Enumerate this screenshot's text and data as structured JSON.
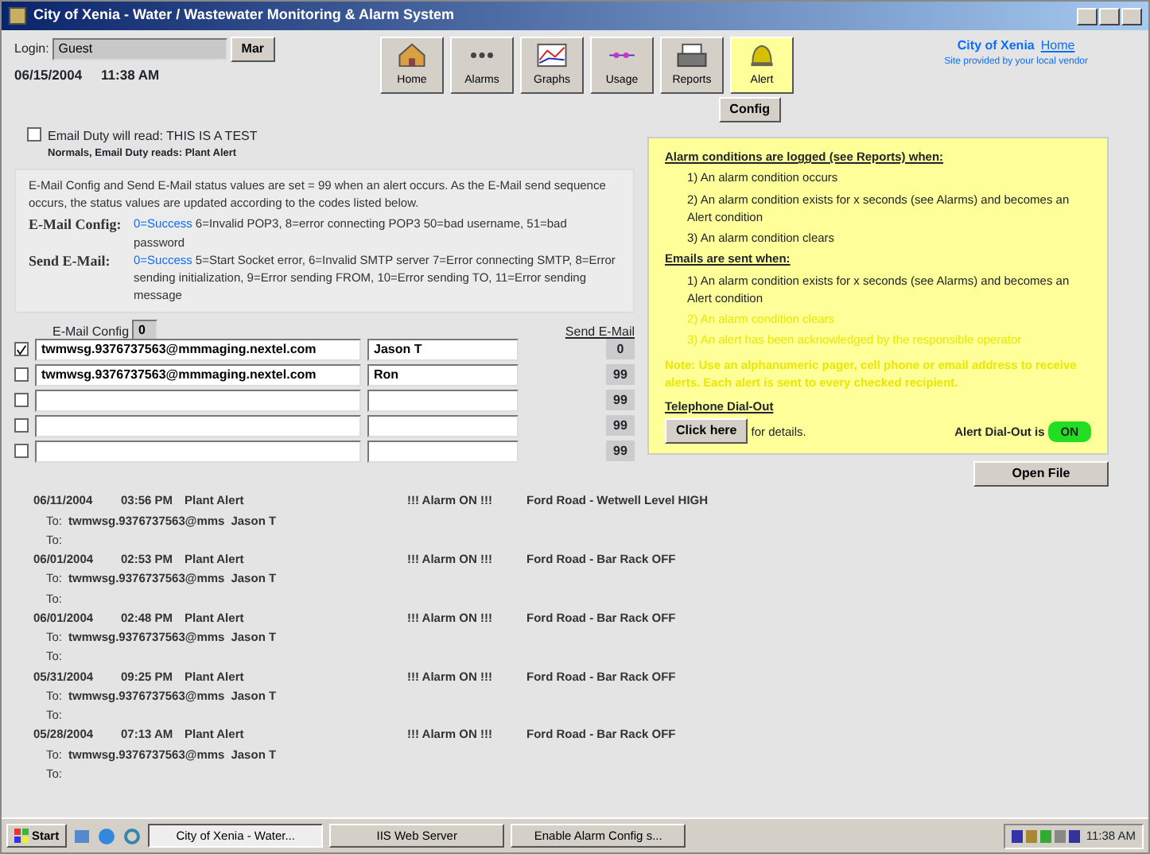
{
  "window": {
    "title": "City of Xenia - Water / Wastewater Monitoring & Alarm System"
  },
  "header": {
    "login_label": "Login:",
    "login_value": "Guest",
    "logout_button": "Mar",
    "date": "06/15/2004",
    "time": "11:38 AM"
  },
  "toolbar": [
    {
      "label": "Home",
      "kind": "home",
      "selected": false
    },
    {
      "label": "Alarms",
      "kind": "alarms",
      "selected": false
    },
    {
      "label": "Graphs",
      "kind": "graphs",
      "selected": false
    },
    {
      "label": "Usage",
      "kind": "usage",
      "selected": false
    },
    {
      "label": "Reports",
      "kind": "reports",
      "selected": false
    },
    {
      "label": "Alert",
      "kind": "alert",
      "selected": true
    }
  ],
  "config_button": "Config",
  "org": {
    "name": "City of Xenia",
    "link": "Home",
    "subtitle": "Site provided by your local vendor"
  },
  "test_mode": {
    "checked": false,
    "label": "Email Duty will read: THIS IS A TEST",
    "note": "Normals, Email Duty reads: Plant Alert"
  },
  "info": {
    "intro": "E-Mail Config and Send E-Mail status values are set = 99 when an alert occurs. As the E-Mail send sequence occurs, the status values are updated according to the codes listed below.",
    "codes": [
      {
        "label": "E-Mail Config:",
        "success": "0=Success",
        "text": "6=Invalid POP3, 8=error connecting POP3 50=bad username, 51=bad password"
      },
      {
        "label": "Send E-Mail:",
        "success": "0=Success",
        "text": "5=Start Socket error, 6=Invalid SMTP server 7=Error connecting SMTP, 8=Error sending initialization, 9=Error sending FROM, 10=Error sending TO, 11=Error sending message"
      }
    ]
  },
  "email_config": {
    "label": "E-Mail Config",
    "value": "0"
  },
  "send_email_label": "Send E-Mail",
  "recipients": [
    {
      "checked": true,
      "email": "twmwsg.9376737563@mmmaging.nextel.com",
      "name": "Jason T",
      "status": "0"
    },
    {
      "checked": false,
      "email": "twmwsg.9376737563@mmmaging.nextel.com",
      "name": "Ron",
      "status": "99"
    },
    {
      "checked": false,
      "status": "99"
    },
    {
      "checked": false,
      "status": "99"
    },
    {
      "checked": false,
      "status": "99"
    }
  ],
  "alert_box": {
    "sections": [
      {
        "heading": "Alarm conditions are logged (see Reports) when:",
        "items": [
          {
            "text": "1) An alarm condition occurs",
            "disabled": false
          },
          {
            "text": "2) An alarm condition exists for x seconds (see Alarms) and becomes an Alert condition",
            "disabled": false
          },
          {
            "text": "3) An alarm condition clears",
            "disabled": false
          }
        ]
      },
      {
        "heading": "Emails are sent when:",
        "items": [
          {
            "text": "1) An alarm condition exists for x seconds (see Alarms) and becomes an Alert condition",
            "disabled": false
          },
          {
            "text": "2) An alarm condition clears",
            "disabled": true
          },
          {
            "text": "3) An alert has been acknowledged by the responsible operator",
            "disabled": true
          }
        ]
      }
    ],
    "note": "Note: Use an alphanumeric pager, cell phone or email address to receive alerts. Each alert is sent to every checked recipient.",
    "dialout_heading": "Telephone Dial-Out",
    "details_button": "Click here",
    "details_text": "for details.",
    "dialout_label": "Alert Dial-Out is",
    "dialout_state": "ON",
    "dialout_on": true
  },
  "open_file_button": "Open File",
  "log": [
    {
      "date": "06/11/2004",
      "time": "03:56 PM",
      "type": "Plant Alert",
      "alarm": "!!! Alarm ON !!!",
      "message": "Ford Road - Wetwell Level HIGH",
      "to_label": "To:",
      "recipient": "twmwsg.9376737563@mms",
      "name": "Jason T",
      "to_label_2": "To:"
    },
    {
      "date": "06/01/2004",
      "time": "02:53 PM",
      "type": "Plant Alert",
      "alarm": "!!! Alarm ON !!!",
      "message": "Ford Road - Bar Rack OFF",
      "to_label": "To:",
      "recipient": "twmwsg.9376737563@mms",
      "name": "Jason T",
      "to_label_2": "To:"
    },
    {
      "date": "06/01/2004",
      "time": "02:48 PM",
      "type": "Plant Alert",
      "alarm": "!!! Alarm ON !!!",
      "message": "Ford Road - Bar Rack OFF",
      "to_label": "To:",
      "recipient": "twmwsg.9376737563@mms",
      "name": "Jason T",
      "to_label_2": "To:"
    },
    {
      "date": "05/31/2004",
      "time": "09:25 PM",
      "type": "Plant Alert",
      "alarm": "!!! Alarm ON !!!",
      "message": "Ford Road - Bar Rack OFF",
      "to_label": "To:",
      "recipient": "twmwsg.9376737563@mms",
      "name": "Jason T",
      "to_label_2": "To:"
    },
    {
      "date": "05/28/2004",
      "time": "07:13 AM",
      "type": "Plant Alert",
      "alarm": "!!! Alarm ON !!!",
      "message": "Ford Road - Bar Rack OFF",
      "to_label": "To:",
      "recipient": "twmwsg.9376737563@mms",
      "name": "Jason T",
      "to_label_2": "To:"
    }
  ],
  "taskbar": {
    "start": "Start",
    "items": [
      {
        "label": "City of Xenia - Water...",
        "selected": true
      },
      {
        "label": "IIS Web Server",
        "selected": false
      },
      {
        "label": "Enable Alarm Config s...",
        "selected": false
      }
    ],
    "clock": "11:38 AM"
  }
}
